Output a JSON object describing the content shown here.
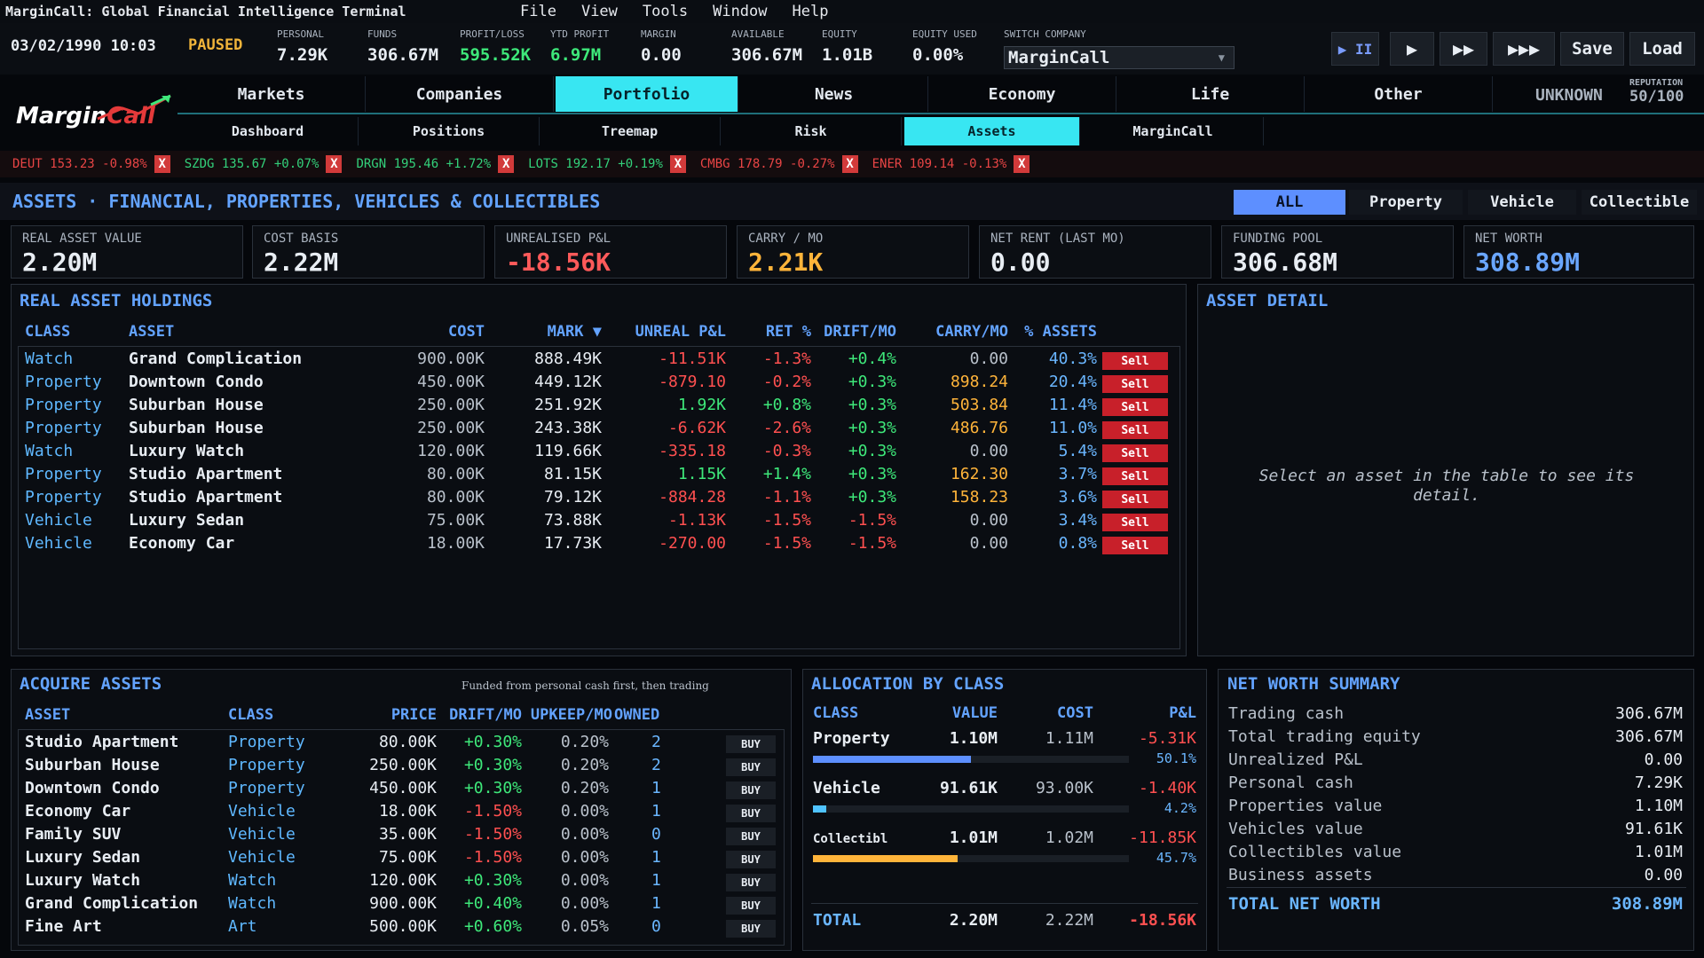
{
  "app": {
    "title": "MarginCall: Global Financial Intelligence Terminal",
    "menus": [
      "File",
      "View",
      "Tools",
      "Window",
      "Help"
    ]
  },
  "status": {
    "datetime": "03/02/1990 10:03",
    "state": "PAUSED",
    "personal": {
      "label": "PERSONAL",
      "value": "7.29K"
    },
    "funds": {
      "label": "FUNDS",
      "value": "306.67M"
    },
    "profit_loss": {
      "label": "PROFIT/LOSS",
      "value": "595.52K"
    },
    "ytd_profit": {
      "label": "YTD PROFIT",
      "value": "6.97M"
    },
    "margin": {
      "label": "MARGIN",
      "value": "0.00"
    },
    "available": {
      "label": "AVAILABLE",
      "value": "306.67M"
    },
    "equity": {
      "label": "EQUITY",
      "value": "1.01B"
    },
    "equity_used": {
      "label": "EQUITY USED",
      "value": "0.00%"
    },
    "switch_company": {
      "label": "SWITCH COMPANY",
      "value": "MarginCall"
    },
    "controls": {
      "pause": "▶ II",
      "play": "▶",
      "fast": "▶▶",
      "faster": "▶▶▶",
      "save": "Save",
      "load": "Load"
    }
  },
  "logo": {
    "part1": "Margin",
    "part2": "Call"
  },
  "main_tabs": [
    "Markets",
    "Companies",
    "Portfolio",
    "News",
    "Economy",
    "Life",
    "Other"
  ],
  "main_tabs_active": "Portfolio",
  "reputation": {
    "status": "UNKNOWN",
    "label": "REPUTATION",
    "value": "50/100"
  },
  "sub_tabs": [
    "Dashboard",
    "Positions",
    "Treemap",
    "Risk",
    "Assets",
    "MarginCall"
  ],
  "sub_tabs_active": "Assets",
  "ticker": [
    {
      "text": "DEUT 153.23 -0.98%",
      "dir": "down"
    },
    {
      "text": "SZDG 135.67 +0.07%",
      "dir": "up"
    },
    {
      "text": "DRGN 195.46 +1.72%",
      "dir": "up"
    },
    {
      "text": "LOTS 192.17 +0.19%",
      "dir": "up"
    },
    {
      "text": "CMBG 178.79 -0.27%",
      "dir": "down"
    },
    {
      "text": "ENER 109.14 -0.13%",
      "dir": "down"
    }
  ],
  "ticker_close": "X",
  "page": {
    "title": "ASSETS · FINANCIAL, PROPERTIES, VEHICLES & COLLECTIBLES",
    "filters": [
      "ALL",
      "Property",
      "Vehicle",
      "Collectible"
    ],
    "filter_active": "ALL"
  },
  "kpis": [
    {
      "label": "REAL ASSET VALUE",
      "value": "2.20M"
    },
    {
      "label": "COST BASIS",
      "value": "2.22M"
    },
    {
      "label": "UNREALISED P&L",
      "value": "-18.56K"
    },
    {
      "label": "CARRY / MO",
      "value": "2.21K"
    },
    {
      "label": "NET RENT (LAST MO)",
      "value": "0.00"
    },
    {
      "label": "FUNDING POOL",
      "value": "306.68M"
    },
    {
      "label": "NET WORTH",
      "value": "308.89M"
    }
  ],
  "holdings": {
    "title": "REAL ASSET HOLDINGS",
    "columns": [
      "CLASS",
      "ASSET",
      "COST",
      "MARK ▼",
      "UNREAL P&L",
      "RET %",
      "DRIFT/MO",
      "CARRY/MO",
      "% ASSETS"
    ],
    "sell_label": "Sell",
    "rows": [
      {
        "class": "Watch",
        "asset": "Grand Complication",
        "cost": "900.00K",
        "mark": "888.49K",
        "pnl": "-11.51K",
        "ret": "-1.3%",
        "drift": "+0.4%",
        "carry": "0.00",
        "pct": "40.3%"
      },
      {
        "class": "Property",
        "asset": "Downtown Condo",
        "cost": "450.00K",
        "mark": "449.12K",
        "pnl": "-879.10",
        "ret": "-0.2%",
        "drift": "+0.3%",
        "carry": "898.24",
        "pct": "20.4%"
      },
      {
        "class": "Property",
        "asset": "Suburban House",
        "cost": "250.00K",
        "mark": "251.92K",
        "pnl": "1.92K",
        "ret": "+0.8%",
        "drift": "+0.3%",
        "carry": "503.84",
        "pct": "11.4%"
      },
      {
        "class": "Property",
        "asset": "Suburban House",
        "cost": "250.00K",
        "mark": "243.38K",
        "pnl": "-6.62K",
        "ret": "-2.6%",
        "drift": "+0.3%",
        "carry": "486.76",
        "pct": "11.0%"
      },
      {
        "class": "Watch",
        "asset": "Luxury Watch",
        "cost": "120.00K",
        "mark": "119.66K",
        "pnl": "-335.18",
        "ret": "-0.3%",
        "drift": "+0.3%",
        "carry": "0.00",
        "pct": "5.4%"
      },
      {
        "class": "Property",
        "asset": "Studio Apartment",
        "cost": "80.00K",
        "mark": "81.15K",
        "pnl": "1.15K",
        "ret": "+1.4%",
        "drift": "+0.3%",
        "carry": "162.30",
        "pct": "3.7%"
      },
      {
        "class": "Property",
        "asset": "Studio Apartment",
        "cost": "80.00K",
        "mark": "79.12K",
        "pnl": "-884.28",
        "ret": "-1.1%",
        "drift": "+0.3%",
        "carry": "158.23",
        "pct": "3.6%"
      },
      {
        "class": "Vehicle",
        "asset": "Luxury Sedan",
        "cost": "75.00K",
        "mark": "73.88K",
        "pnl": "-1.13K",
        "ret": "-1.5%",
        "drift": "-1.5%",
        "carry": "0.00",
        "pct": "3.4%"
      },
      {
        "class": "Vehicle",
        "asset": "Economy Car",
        "cost": "18.00K",
        "mark": "17.73K",
        "pnl": "-270.00",
        "ret": "-1.5%",
        "drift": "-1.5%",
        "carry": "0.00",
        "pct": "0.8%"
      }
    ]
  },
  "detail": {
    "title": "ASSET DETAIL",
    "placeholder": "Select an asset in the table to see its detail."
  },
  "acquire": {
    "title": "ACQUIRE ASSETS",
    "note": "Funded from personal cash first, then trading",
    "columns": [
      "ASSET",
      "CLASS",
      "PRICE",
      "DRIFT/MO",
      "UPKEEP/MO",
      "OWNED"
    ],
    "buy_label": "BUY",
    "rows": [
      {
        "asset": "Studio Apartment",
        "class": "Property",
        "price": "80.00K",
        "drift": "+0.30%",
        "upkeep": "0.20%",
        "owned": "2"
      },
      {
        "asset": "Suburban House",
        "class": "Property",
        "price": "250.00K",
        "drift": "+0.30%",
        "upkeep": "0.20%",
        "owned": "2"
      },
      {
        "asset": "Downtown Condo",
        "class": "Property",
        "price": "450.00K",
        "drift": "+0.30%",
        "upkeep": "0.20%",
        "owned": "1"
      },
      {
        "asset": "Economy Car",
        "class": "Vehicle",
        "price": "18.00K",
        "drift": "-1.50%",
        "upkeep": "0.00%",
        "owned": "1"
      },
      {
        "asset": "Family SUV",
        "class": "Vehicle",
        "price": "35.00K",
        "drift": "-1.50%",
        "upkeep": "0.00%",
        "owned": "0"
      },
      {
        "asset": "Luxury Sedan",
        "class": "Vehicle",
        "price": "75.00K",
        "drift": "-1.50%",
        "upkeep": "0.00%",
        "owned": "1"
      },
      {
        "asset": "Luxury Watch",
        "class": "Watch",
        "price": "120.00K",
        "drift": "+0.30%",
        "upkeep": "0.00%",
        "owned": "1"
      },
      {
        "asset": "Grand Complication",
        "class": "Watch",
        "price": "900.00K",
        "drift": "+0.40%",
        "upkeep": "0.00%",
        "owned": "1"
      },
      {
        "asset": "Fine Art",
        "class": "Art",
        "price": "500.00K",
        "drift": "+0.60%",
        "upkeep": "0.05%",
        "owned": "0"
      }
    ]
  },
  "allocation": {
    "title": "ALLOCATION BY CLASS",
    "columns": [
      "CLASS",
      "VALUE",
      "COST",
      "P&L"
    ],
    "rows": [
      {
        "class": "Property",
        "value": "1.10M",
        "cost": "1.11M",
        "pnl": "-5.31K",
        "pct_label": "50.1%",
        "share": 0.501,
        "color": "#5d8fff"
      },
      {
        "class": "Vehicle",
        "value": "91.61K",
        "cost": "93.00K",
        "pnl": "-1.40K",
        "pct_label": "4.2%",
        "share": 0.042,
        "color": "#4fc3ff"
      },
      {
        "class": "Collectibl",
        "value": "1.01M",
        "cost": "1.02M",
        "pnl": "-11.85K",
        "pct_label": "45.7%",
        "share": 0.457,
        "color": "#ffb43a"
      }
    ],
    "total": {
      "label": "TOTAL",
      "value": "2.20M",
      "cost": "2.22M",
      "pnl": "-18.56K"
    }
  },
  "networth": {
    "title": "NET WORTH SUMMARY",
    "rows": [
      {
        "label": "Trading cash",
        "value": "306.67M"
      },
      {
        "label": "Total trading equity",
        "value": "306.67M"
      },
      {
        "label": "Unrealized P&L",
        "value": "0.00"
      },
      {
        "label": "Personal cash",
        "value": "7.29K"
      },
      {
        "label": "Properties value",
        "value": "1.10M"
      },
      {
        "label": "Vehicles value",
        "value": "91.61K"
      },
      {
        "label": "Collectibles value",
        "value": "1.01M"
      },
      {
        "label": "Business assets",
        "value": "0.00"
      }
    ],
    "total": {
      "label": "TOTAL NET WORTH",
      "value": "308.89M"
    }
  },
  "colors": {
    "accent": "#38e6f2",
    "blue": "#63a3ff",
    "green": "#3ee87a",
    "red": "#ff5050",
    "orange": "#ffb43a"
  }
}
